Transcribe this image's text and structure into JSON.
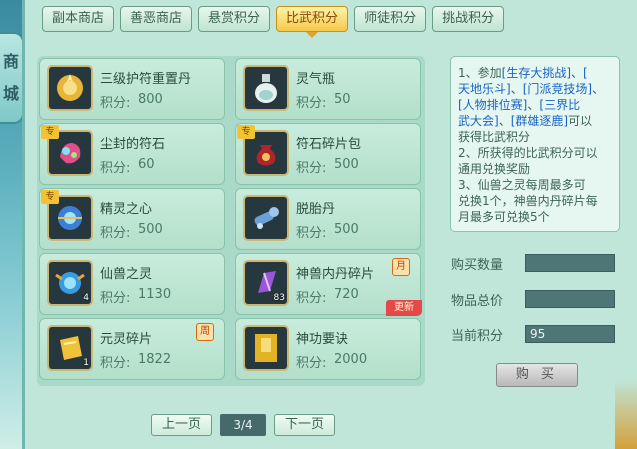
{
  "sidebar": {
    "shop_label_1": "商",
    "shop_label_2": "城"
  },
  "tabs": [
    {
      "label": "副本商店",
      "active": false
    },
    {
      "label": "善恶商店",
      "active": false
    },
    {
      "label": "悬赏积分",
      "active": false
    },
    {
      "label": "比武积分",
      "active": true
    },
    {
      "label": "师徒积分",
      "active": false
    },
    {
      "label": "挑战积分",
      "active": false
    }
  ],
  "price_label": "积分:",
  "items": [
    {
      "name": "三级护符重置丹",
      "price": "800",
      "icon": "gold-lotus-charm-icon"
    },
    {
      "name": "灵气瓶",
      "price": "50",
      "icon": "spirit-bottle-icon"
    },
    {
      "name": "尘封的符石",
      "price": "60",
      "icon": "sealed-runestone-icon",
      "badge": "专"
    },
    {
      "name": "符石碎片包",
      "price": "500",
      "icon": "rune-shard-bag-icon",
      "badge": "专"
    },
    {
      "name": "精灵之心",
      "price": "500",
      "icon": "spirit-heart-icon",
      "badge": "专"
    },
    {
      "name": "脱胎丹",
      "price": "500",
      "icon": "rebirth-pill-icon"
    },
    {
      "name": "仙兽之灵",
      "price": "1130",
      "icon": "beast-spirit-orb-icon",
      "count": "4"
    },
    {
      "name": "神兽内丹碎片",
      "price": "720",
      "icon": "divine-beast-core-shard-icon",
      "count": "83",
      "period": "月",
      "new_tag": "更新"
    },
    {
      "name": "元灵碎片",
      "price": "1822",
      "icon": "yuanling-fragment-icon",
      "count": "1",
      "period": "周"
    },
    {
      "name": "神功要诀",
      "price": "2000",
      "icon": "martial-manual-icon"
    }
  ],
  "pager": {
    "prev": "上一页",
    "page": "3/4",
    "next": "下一页"
  },
  "info": {
    "l1a": "1、参加",
    "l1b": "[生存大挑战]",
    "l1c": "、[",
    "l2a": "天地乐斗]",
    "l2b": "、",
    "l2c": "[门派竞技场]",
    "l2d": "、",
    "l3a": "[人物排位赛]",
    "l3b": "、",
    "l3c": "[三界比",
    "l4a": "武大会]",
    "l4b": "、",
    "l4c": "[群雄逐鹿]",
    "l4d": "可以",
    "l5": "获得比武积分",
    "l6": "2、所获得的比武积分可以",
    "l7": "通用兑换奖励",
    "l8": "3、仙兽之灵每周最多可",
    "l9": "兑换1个，神兽内丹碎片每",
    "l10": "月最多可兑换5个"
  },
  "form": {
    "qty_label": "购买数量",
    "qty_value": "",
    "total_label": "物品总价",
    "total_value": "",
    "current_label": "当前积分",
    "current_value": "95"
  },
  "buy_label": "购 买"
}
